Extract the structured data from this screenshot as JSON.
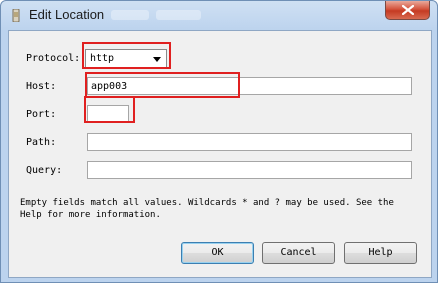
{
  "window": {
    "title": "Edit Location",
    "close_icon": "close-icon"
  },
  "form": {
    "protocol": {
      "label": "Protocol:",
      "value": "http"
    },
    "host": {
      "label": "Host:",
      "value": "app003"
    },
    "port": {
      "label": "Port:",
      "value": ""
    },
    "path": {
      "label": "Path:",
      "value": ""
    },
    "query": {
      "label": "Query:",
      "value": ""
    }
  },
  "help_text": "Empty fields match all values. Wildcards * and ? may be used. See the Help for more information.",
  "buttons": {
    "ok": "OK",
    "cancel": "Cancel",
    "help": "Help"
  },
  "colors": {
    "highlight": "#e02020",
    "titlebar": "#bcd3ee",
    "close": "#c53a22"
  }
}
